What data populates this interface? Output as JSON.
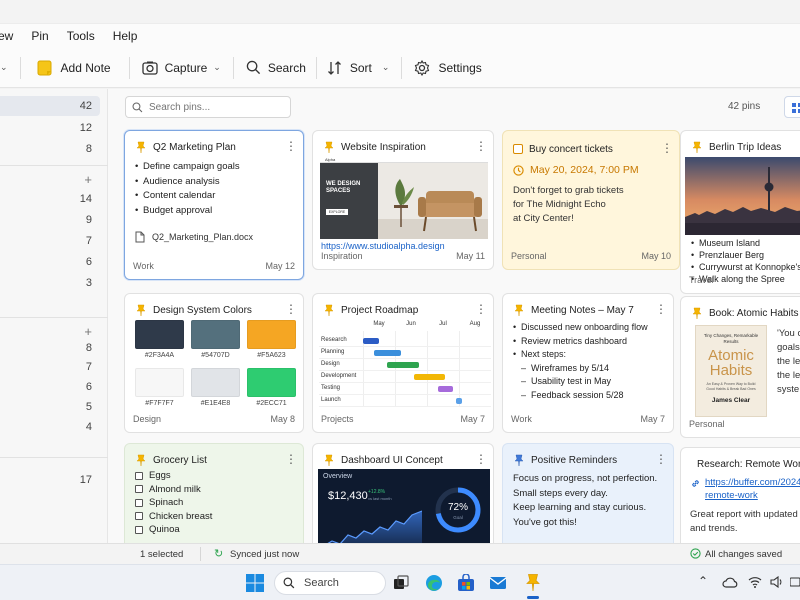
{
  "menu": [
    "ew",
    "Pin",
    "Tools",
    "Help"
  ],
  "toolbar": {
    "add_note": "Add Note",
    "capture": "Capture",
    "search": "Search",
    "sort": "Sort",
    "settings": "Settings"
  },
  "sidebar": {
    "counts": [
      "42",
      "12",
      "8",
      "+",
      "14",
      "9",
      "7",
      "6",
      "3",
      "+",
      "8",
      "7",
      "6",
      "5",
      "4",
      "17"
    ]
  },
  "main": {
    "search_placeholder": "Search pins...",
    "pin_count": "42 pins"
  },
  "cards": {
    "q2": {
      "title": "Q2 Marketing Plan",
      "items": [
        "Define campaign goals",
        "Audience analysis",
        "Content calendar",
        "Budget approval"
      ],
      "file": "Q2_Marketing_Plan.docx",
      "tag": "Work",
      "date": "May 12"
    },
    "website": {
      "title": "Website Inspiration",
      "shot_logo": "Alpha",
      "shot_heading": "WE DESIGN SPACES",
      "shot_button": "EXPLORE",
      "url": "https://www.studioalpha.design",
      "tag": "Inspiration",
      "date": "May 11"
    },
    "concert": {
      "title": "Buy concert tickets",
      "when": "May 20, 2024, 7:00 PM",
      "lines": [
        "Don't forget to grab tickets",
        "for The Midnight Echo",
        "at City Center!"
      ],
      "tag": "Personal",
      "date": "May 10"
    },
    "berlin": {
      "title": "Berlin Trip Ideas",
      "items": [
        "Museum Island",
        "Prenzlauer Berg",
        "Currywurst at Konnopke's",
        "Walk along the Spree"
      ],
      "tag": "Travel"
    },
    "colors": {
      "title": "Design System Colors",
      "swatches": [
        {
          "hex": "#2F3A4A",
          "label": "#2F3A4A"
        },
        {
          "hex": "#54707D",
          "label": "#54707D"
        },
        {
          "hex": "#F5A623",
          "label": "#F5A623"
        },
        {
          "hex": "#F7F7F7",
          "label": "#F7F7F7"
        },
        {
          "hex": "#E1E4E8",
          "label": "#E1E4E8"
        },
        {
          "hex": "#2ECC71",
          "label": "#2ECC71"
        }
      ],
      "tag": "Design",
      "date": "May 8"
    },
    "roadmap": {
      "title": "Project Roadmap",
      "months": [
        "May",
        "Jun",
        "Jul",
        "Aug"
      ],
      "rows": [
        {
          "label": "Research",
          "start": 0.0,
          "end": 0.5,
          "color": "#2c5cc5"
        },
        {
          "label": "Planning",
          "start": 0.35,
          "end": 1.2,
          "color": "#3b8fdc"
        },
        {
          "label": "Design",
          "start": 0.75,
          "end": 1.75,
          "color": "#2ea44f"
        },
        {
          "label": "Development",
          "start": 1.6,
          "end": 2.55,
          "color": "#f2b705"
        },
        {
          "label": "Testing",
          "start": 2.35,
          "end": 2.8,
          "color": "#a66bdb"
        },
        {
          "label": "Launch",
          "start": 2.9,
          "end": 3.1,
          "color": "#5aa0e8"
        }
      ],
      "tag": "Projects",
      "date": "May 7"
    },
    "meeting": {
      "title": "Meeting Notes – May 7",
      "items": [
        {
          "text": "Discussed new onboarding flow",
          "sub": false
        },
        {
          "text": "Review metrics dashboard",
          "sub": false
        },
        {
          "text": "Next steps:",
          "sub": false
        },
        {
          "text": "Wireframes by 5/14",
          "sub": true
        },
        {
          "text": "Usability test in May",
          "sub": true
        },
        {
          "text": "Feedback session 5/28",
          "sub": true
        }
      ],
      "tag": "Work",
      "date": "May 7"
    },
    "book": {
      "title": "Book: Atomic Habits",
      "cover_top": "Tiny Changes, Remarkable Results",
      "cover_word1": "Atomic",
      "cover_word2": "Habits",
      "cover_mid": "An Easy & Proven Way to Build Good Habits & Break Bad Ones",
      "cover_author": "James Clear",
      "snippet": [
        "'You c",
        "goals",
        "the le",
        "the le",
        "syste"
      ],
      "tag": "Personal"
    },
    "grocery": {
      "title": "Grocery List",
      "items": [
        "Eggs",
        "Almond milk",
        "Spinach",
        "Chicken breast",
        "Quinoa"
      ]
    },
    "dashboard": {
      "title": "Dashboard UI Concept",
      "overview": "Overview",
      "amount": "$12,430",
      "delta": "+12.8%",
      "delta_sub": "vs last month",
      "pct_value": 0.72,
      "pct": "72%",
      "pct_label": "Goal"
    },
    "reminders": {
      "title": "Positive Reminders",
      "lines": [
        "Focus on progress, not perfection.",
        "Small steps every day.",
        "Keep learning and stay curious.",
        "You've got this!"
      ]
    },
    "research": {
      "title": "Research: Remote Work",
      "link1": "https://buffer.com/2024",
      "link2": "remote-work",
      "text1": "Great report with updated sta",
      "text2": "and trends."
    }
  },
  "status": {
    "selected": "1 selected",
    "synced": "Synced just now",
    "saved": "All changes saved"
  },
  "taskbar": {
    "search": "Search"
  }
}
